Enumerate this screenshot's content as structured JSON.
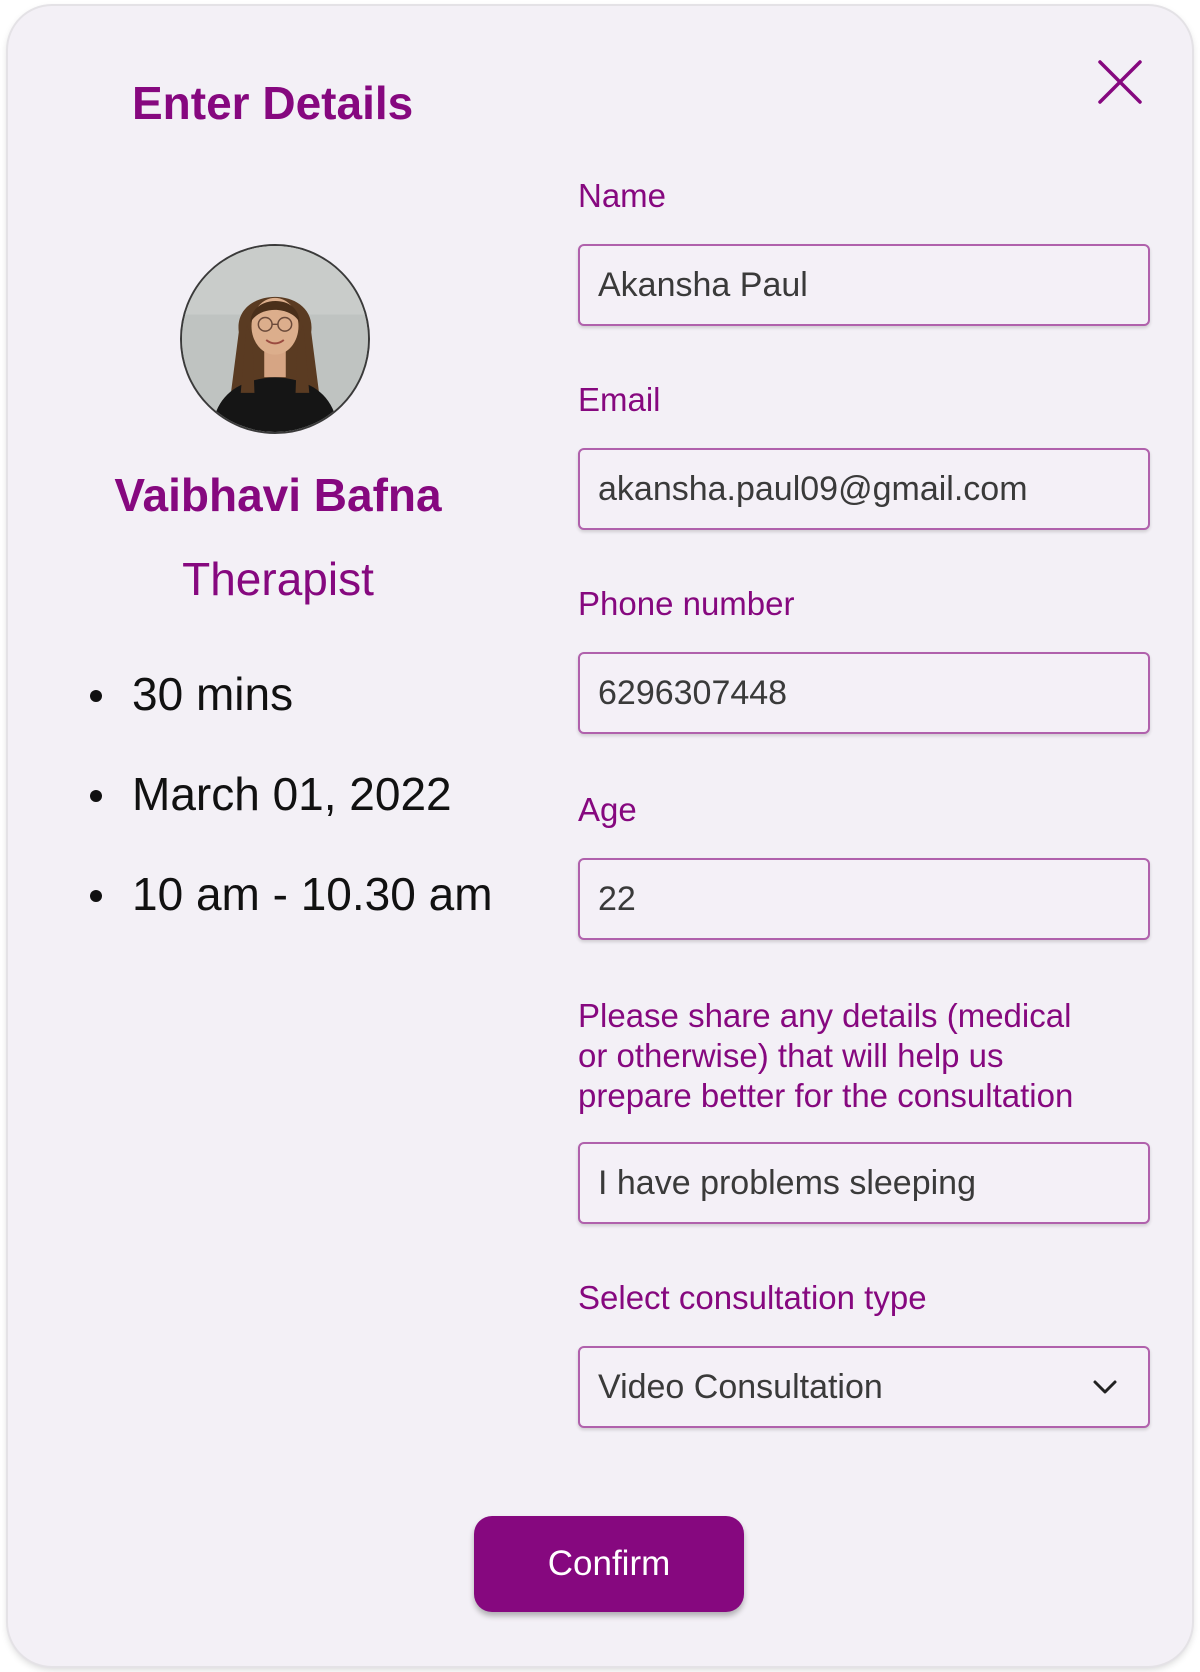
{
  "dialog": {
    "title": "Enter Details",
    "close_icon": "close-icon"
  },
  "therapist": {
    "name": "Vaibhavi Bafna",
    "role": "Therapist",
    "details": [
      "30 mins",
      "March 01, 2022",
      "10 am - 10.30 am"
    ]
  },
  "form": {
    "name_label": "Name",
    "name_value": "Akansha Paul",
    "email_label": "Email",
    "email_value": "akansha.paul09@gmail.com",
    "phone_label": "Phone number",
    "phone_value": "6296307448",
    "age_label": "Age",
    "age_value": "22",
    "details_label_lines": [
      "Please share any details (medical",
      "or otherwise) that will help us",
      "prepare better for the consultation"
    ],
    "details_value": "I have problems sleeping",
    "type_label": "Select consultation type",
    "type_value": "Video Consultation",
    "type_icon": "chevron-down-icon"
  },
  "confirm_label": "Confirm",
  "colors": {
    "accent": "#86087f",
    "background": "#f3f0f6",
    "field_border": "#b061ac"
  }
}
